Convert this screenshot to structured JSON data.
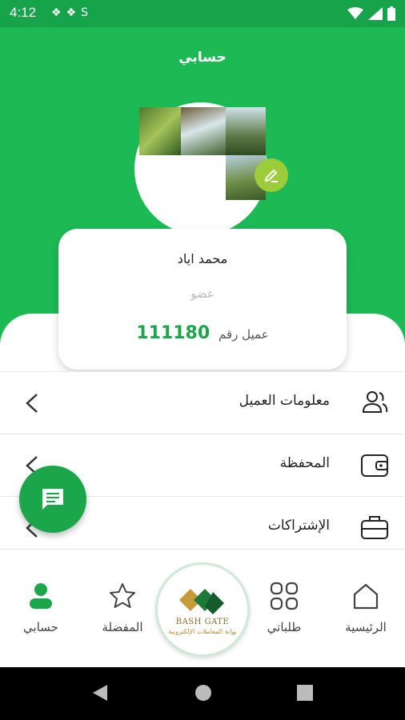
{
  "status_bar": {
    "time": "4:12",
    "left_icons": [
      "diamond-icon",
      "diamond-icon",
      "s-icon"
    ],
    "right_icons": [
      "wifi-icon",
      "signal-icon",
      "battery-icon"
    ]
  },
  "header": {
    "title": "حسابي"
  },
  "profile": {
    "name": "محمد اياد",
    "role": "عضو",
    "customer_label": "عميل رقم",
    "customer_number": "111180"
  },
  "menu": {
    "items": [
      {
        "label": "معلومات العميل",
        "icon": "users-icon"
      },
      {
        "label": "المحفظة",
        "icon": "wallet-icon"
      },
      {
        "label": "الإشتراكات",
        "icon": "briefcase-icon"
      }
    ]
  },
  "fab": {
    "icon": "chat-icon"
  },
  "bottom_nav": {
    "items": [
      {
        "label": "الرئيسية",
        "icon": "home-icon"
      },
      {
        "label": "طلباتي",
        "icon": "grid-icon"
      },
      {
        "label": "المفضلة",
        "icon": "star-icon"
      },
      {
        "label": "حسابي",
        "icon": "person-icon"
      }
    ],
    "logo": {
      "title": "BASH GATE",
      "subtitle": "بوابة المعاملات الإلكترونية"
    }
  },
  "colors": {
    "primary": "#1db954",
    "accent": "#1ca64c",
    "badge": "#9ccc3a"
  }
}
